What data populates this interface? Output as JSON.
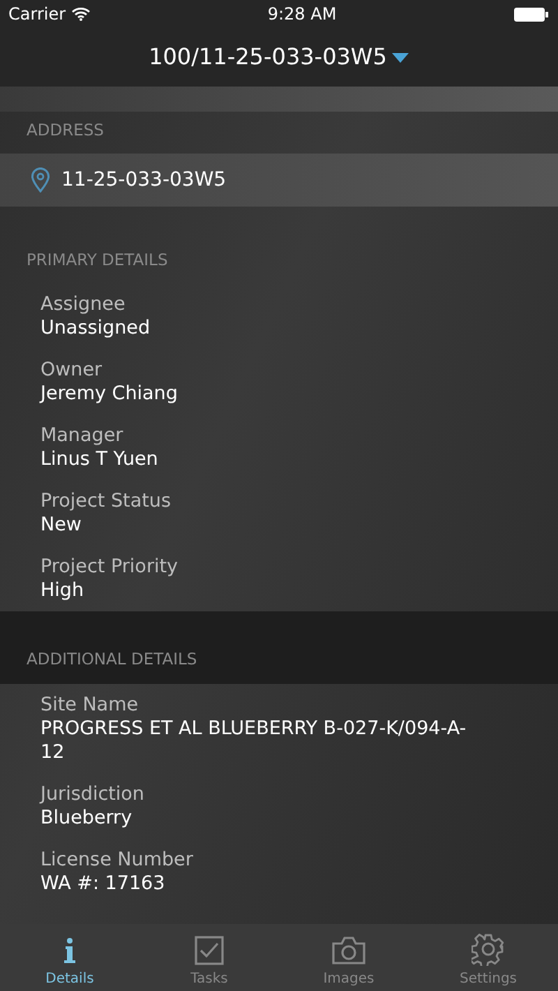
{
  "status_bar": {
    "carrier": "Carrier",
    "time": "9:28 AM"
  },
  "nav": {
    "title": "100/11-25-033-03W5"
  },
  "sections": [
    {
      "kind": "address",
      "header": "ADDRESS",
      "value": "11-25-033-03W5"
    },
    {
      "kind": "fields",
      "header": "PRIMARY DETAILS",
      "fields": [
        {
          "label": "Assignee",
          "value": "Unassigned"
        },
        {
          "label": "Owner",
          "value": "Jeremy Chiang"
        },
        {
          "label": "Manager",
          "value": "Linus T Yuen"
        },
        {
          "label": "Project Status",
          "value": "New"
        },
        {
          "label": "Project Priority",
          "value": "High"
        }
      ]
    },
    {
      "kind": "fields",
      "header": "ADDITIONAL DETAILS",
      "fields": [
        {
          "label": "Site Name",
          "value": "PROGRESS ET AL BLUEBERRY B-027-K/094-A-12"
        },
        {
          "label": "Jurisdiction",
          "value": "Blueberry"
        },
        {
          "label": "License Number",
          "value": "WA #: 17163"
        }
      ]
    }
  ],
  "tabs": [
    {
      "label": "Details",
      "selected": true
    },
    {
      "label": "Tasks",
      "selected": false
    },
    {
      "label": "Images",
      "selected": false
    },
    {
      "label": "Settings",
      "selected": false
    }
  ]
}
